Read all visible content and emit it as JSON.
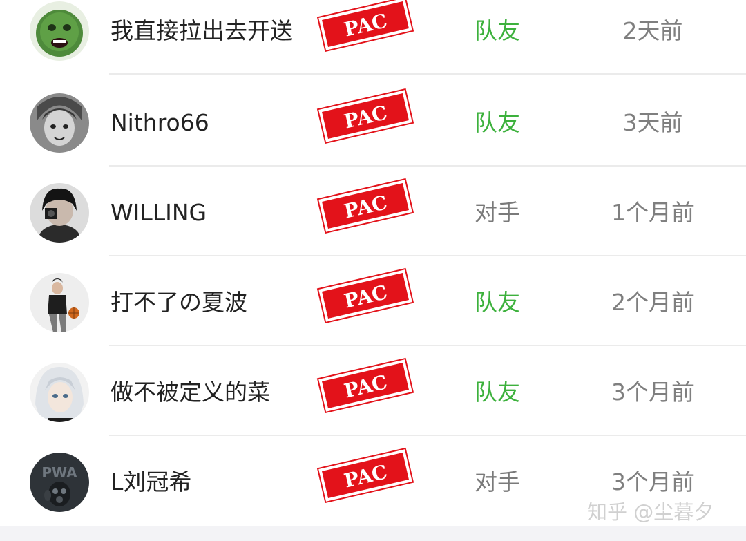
{
  "stamp_text": "PAC",
  "rows": [
    {
      "name": "我直接拉出去开送",
      "relation": "队友",
      "relation_type": "teammate",
      "time": "2天前",
      "avatar": "green-face-avatar"
    },
    {
      "name": "Nithro66",
      "relation": "队友",
      "relation_type": "teammate",
      "time": "3天前",
      "avatar": "gray-anime-avatar"
    },
    {
      "name": "WILLING",
      "relation": "对手",
      "relation_type": "opponent",
      "time": "1个月前",
      "avatar": "dark-hair-avatar"
    },
    {
      "name": "打不了の夏波",
      "relation": "队友",
      "relation_type": "teammate",
      "time": "2个月前",
      "avatar": "basketball-player-avatar"
    },
    {
      "name": "做不被定义的菜",
      "relation": "队友",
      "relation_type": "teammate",
      "time": "3个月前",
      "avatar": "white-hair-anime-avatar"
    },
    {
      "name": "L刘冠希",
      "relation": "对手",
      "relation_type": "opponent",
      "time": "3个月前",
      "avatar": "pwa-gasmask-avatar"
    }
  ],
  "watermark": "知乎 @尘暮夕",
  "colors": {
    "teammate": "#3db13d",
    "opponent": "#7a7a7a",
    "stamp_red": "#e3121a"
  }
}
